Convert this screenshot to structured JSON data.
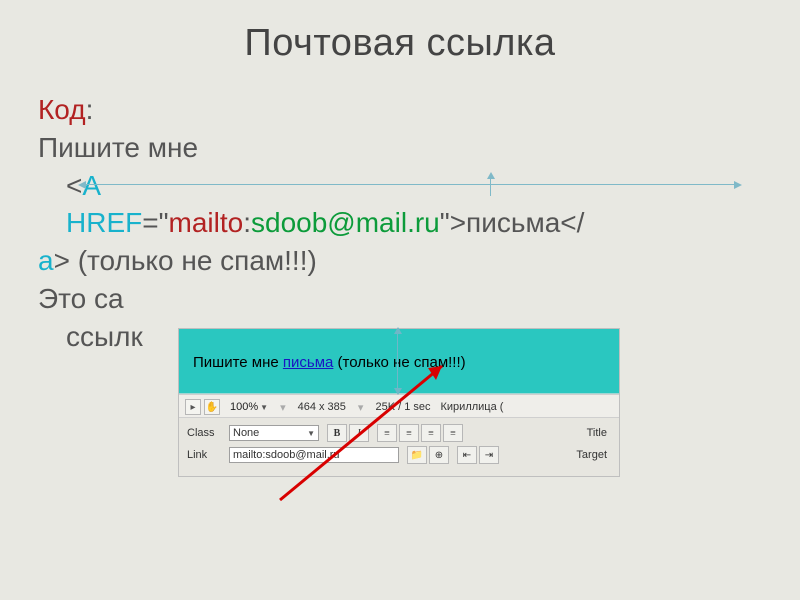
{
  "title": "Почтовая ссылка",
  "code_label": "Код",
  "line1": "Пишите мне",
  "code": {
    "lt1": "<",
    "a1": "А",
    "href": "HREF",
    "eq_quote": "=\"",
    "mailto": "mailto",
    "colon": ":",
    "email": "sdoob@mail.ru",
    "close1": "\">",
    "linktext": "письма",
    "lt2": "</",
    "a2": "a",
    "gt2": ">",
    "trailing": " (только не спам!!!)"
  },
  "para_prefix": "Это са",
  "para_line2": "ссылк",
  "preview": {
    "prefix": "Пишите мне ",
    "link": "письма",
    "suffix": " (только не спам!!!)"
  },
  "toolbar": {
    "zoom": "100%",
    "dims": "464 x 385",
    "size": "25K / 1 sec",
    "encoding": "Кириллица ("
  },
  "props": {
    "class_label": "Class",
    "class_value": "None",
    "link_label": "Link",
    "link_value": "mailto:sdoob@mail.ru",
    "title_label": "Title",
    "target_label": "Target",
    "bold": "B",
    "italic": "I"
  }
}
